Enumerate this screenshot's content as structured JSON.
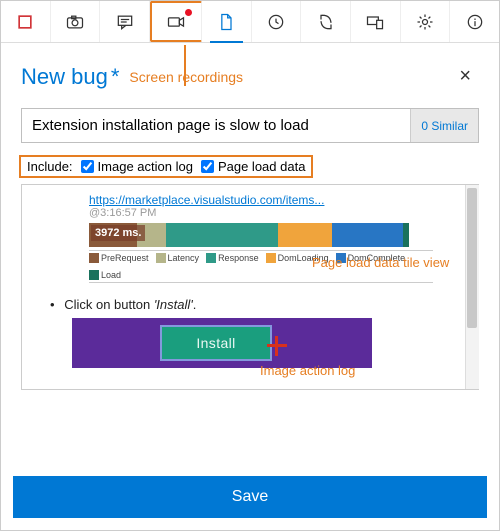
{
  "toolbar": {
    "items": [
      {
        "name": "record-icon"
      },
      {
        "name": "camera-icon"
      },
      {
        "name": "comment-icon"
      },
      {
        "name": "video-icon"
      },
      {
        "name": "document-icon"
      },
      {
        "name": "history-icon"
      },
      {
        "name": "sync-icon"
      },
      {
        "name": "devices-icon"
      },
      {
        "name": "settings-icon"
      },
      {
        "name": "info-icon"
      }
    ]
  },
  "header": {
    "title": "New bug",
    "required": "*",
    "screen_recordings_label": "Screen recordings",
    "close_label": "×"
  },
  "title_field": {
    "value": "Extension installation page is slow to load",
    "similar": "0 Similar"
  },
  "include": {
    "label": "Include:",
    "opt1": "Image action log",
    "opt2": "Page load data"
  },
  "content": {
    "url": "https://marketplace.visualstudio.com/items...",
    "timestamp": "@3:16:57 PM",
    "ms_label": "3972 ms.",
    "legend": [
      "PreRequest",
      "Latency",
      "Response",
      "DomLoading",
      "DomComplete",
      "Load"
    ],
    "step_prefix": "Click on button",
    "step_target": "'Install'",
    "install_label": "Install",
    "annot_tile": "Page load data tile view",
    "annot_action": "Image action log"
  },
  "chart_data": {
    "type": "bar",
    "orientation": "horizontal-stacked",
    "total_label": "3972 ms.",
    "series": [
      {
        "name": "PreRequest",
        "color": "#8a5a3a",
        "value": 600
      },
      {
        "name": "Latency",
        "color": "#b5b58a",
        "value": 340
      },
      {
        "name": "Response",
        "color": "#2f9a88",
        "value": 1400
      },
      {
        "name": "DomLoading",
        "color": "#f0a43c",
        "value": 700
      },
      {
        "name": "DomComplete",
        "color": "#2876c4",
        "value": 880
      },
      {
        "name": "Load",
        "color": "#1a725d",
        "value": 52
      }
    ]
  },
  "save_label": "Save"
}
